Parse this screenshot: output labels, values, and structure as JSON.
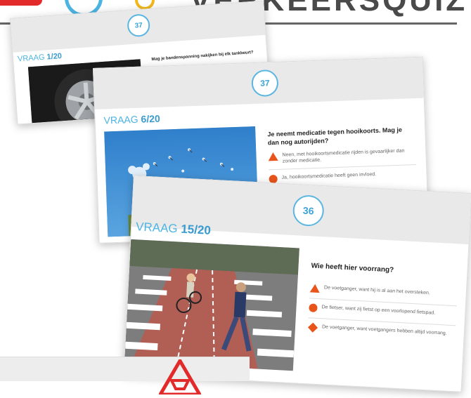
{
  "brand": {
    "logo_text": "VERKEERSQUIZ"
  },
  "cards": [
    {
      "id": "card1",
      "badge": "37",
      "vraag_label": "VRAAG ",
      "vraag_number": "1",
      "vraag_total": "/20",
      "question": "Mag je bandenspanning nakijken bij elk tankbeurt?",
      "answers": []
    },
    {
      "id": "card2",
      "badge": "37",
      "vraag_label": "VRAAG ",
      "vraag_number": "6",
      "vraag_total": "/20",
      "question": "Je neemt medicatie tegen hooikoorts. Mag je dan nog autorijden?",
      "answers": [
        {
          "icon": "triangle",
          "text": "Neen, met hooikoortsmedicatie rijden is gevaarlijker dan zonder medicatie."
        },
        {
          "icon": "circle",
          "text": "Ja, hooikoortsmedicatie heeft geen invloed."
        }
      ]
    },
    {
      "id": "card3",
      "badge": "36",
      "vraag_label": "VRAAG ",
      "vraag_number": "15",
      "vraag_total": "/20",
      "question": "Wie heeft hier voorrang?",
      "answers": [
        {
          "icon": "triangle",
          "text": "De voetganger, want hij is al aan het oversteken."
        },
        {
          "icon": "circle",
          "text": "De fietser, want zij fietst op een voorlopend fietspad."
        },
        {
          "icon": "diamond",
          "text": "De voetganger, want voetgangers hebben altijd voorrang."
        }
      ]
    }
  ],
  "colors": {
    "accent": "#4cb4e2",
    "answer_icon": "#e8541a",
    "brand_red": "#e32a2a"
  }
}
